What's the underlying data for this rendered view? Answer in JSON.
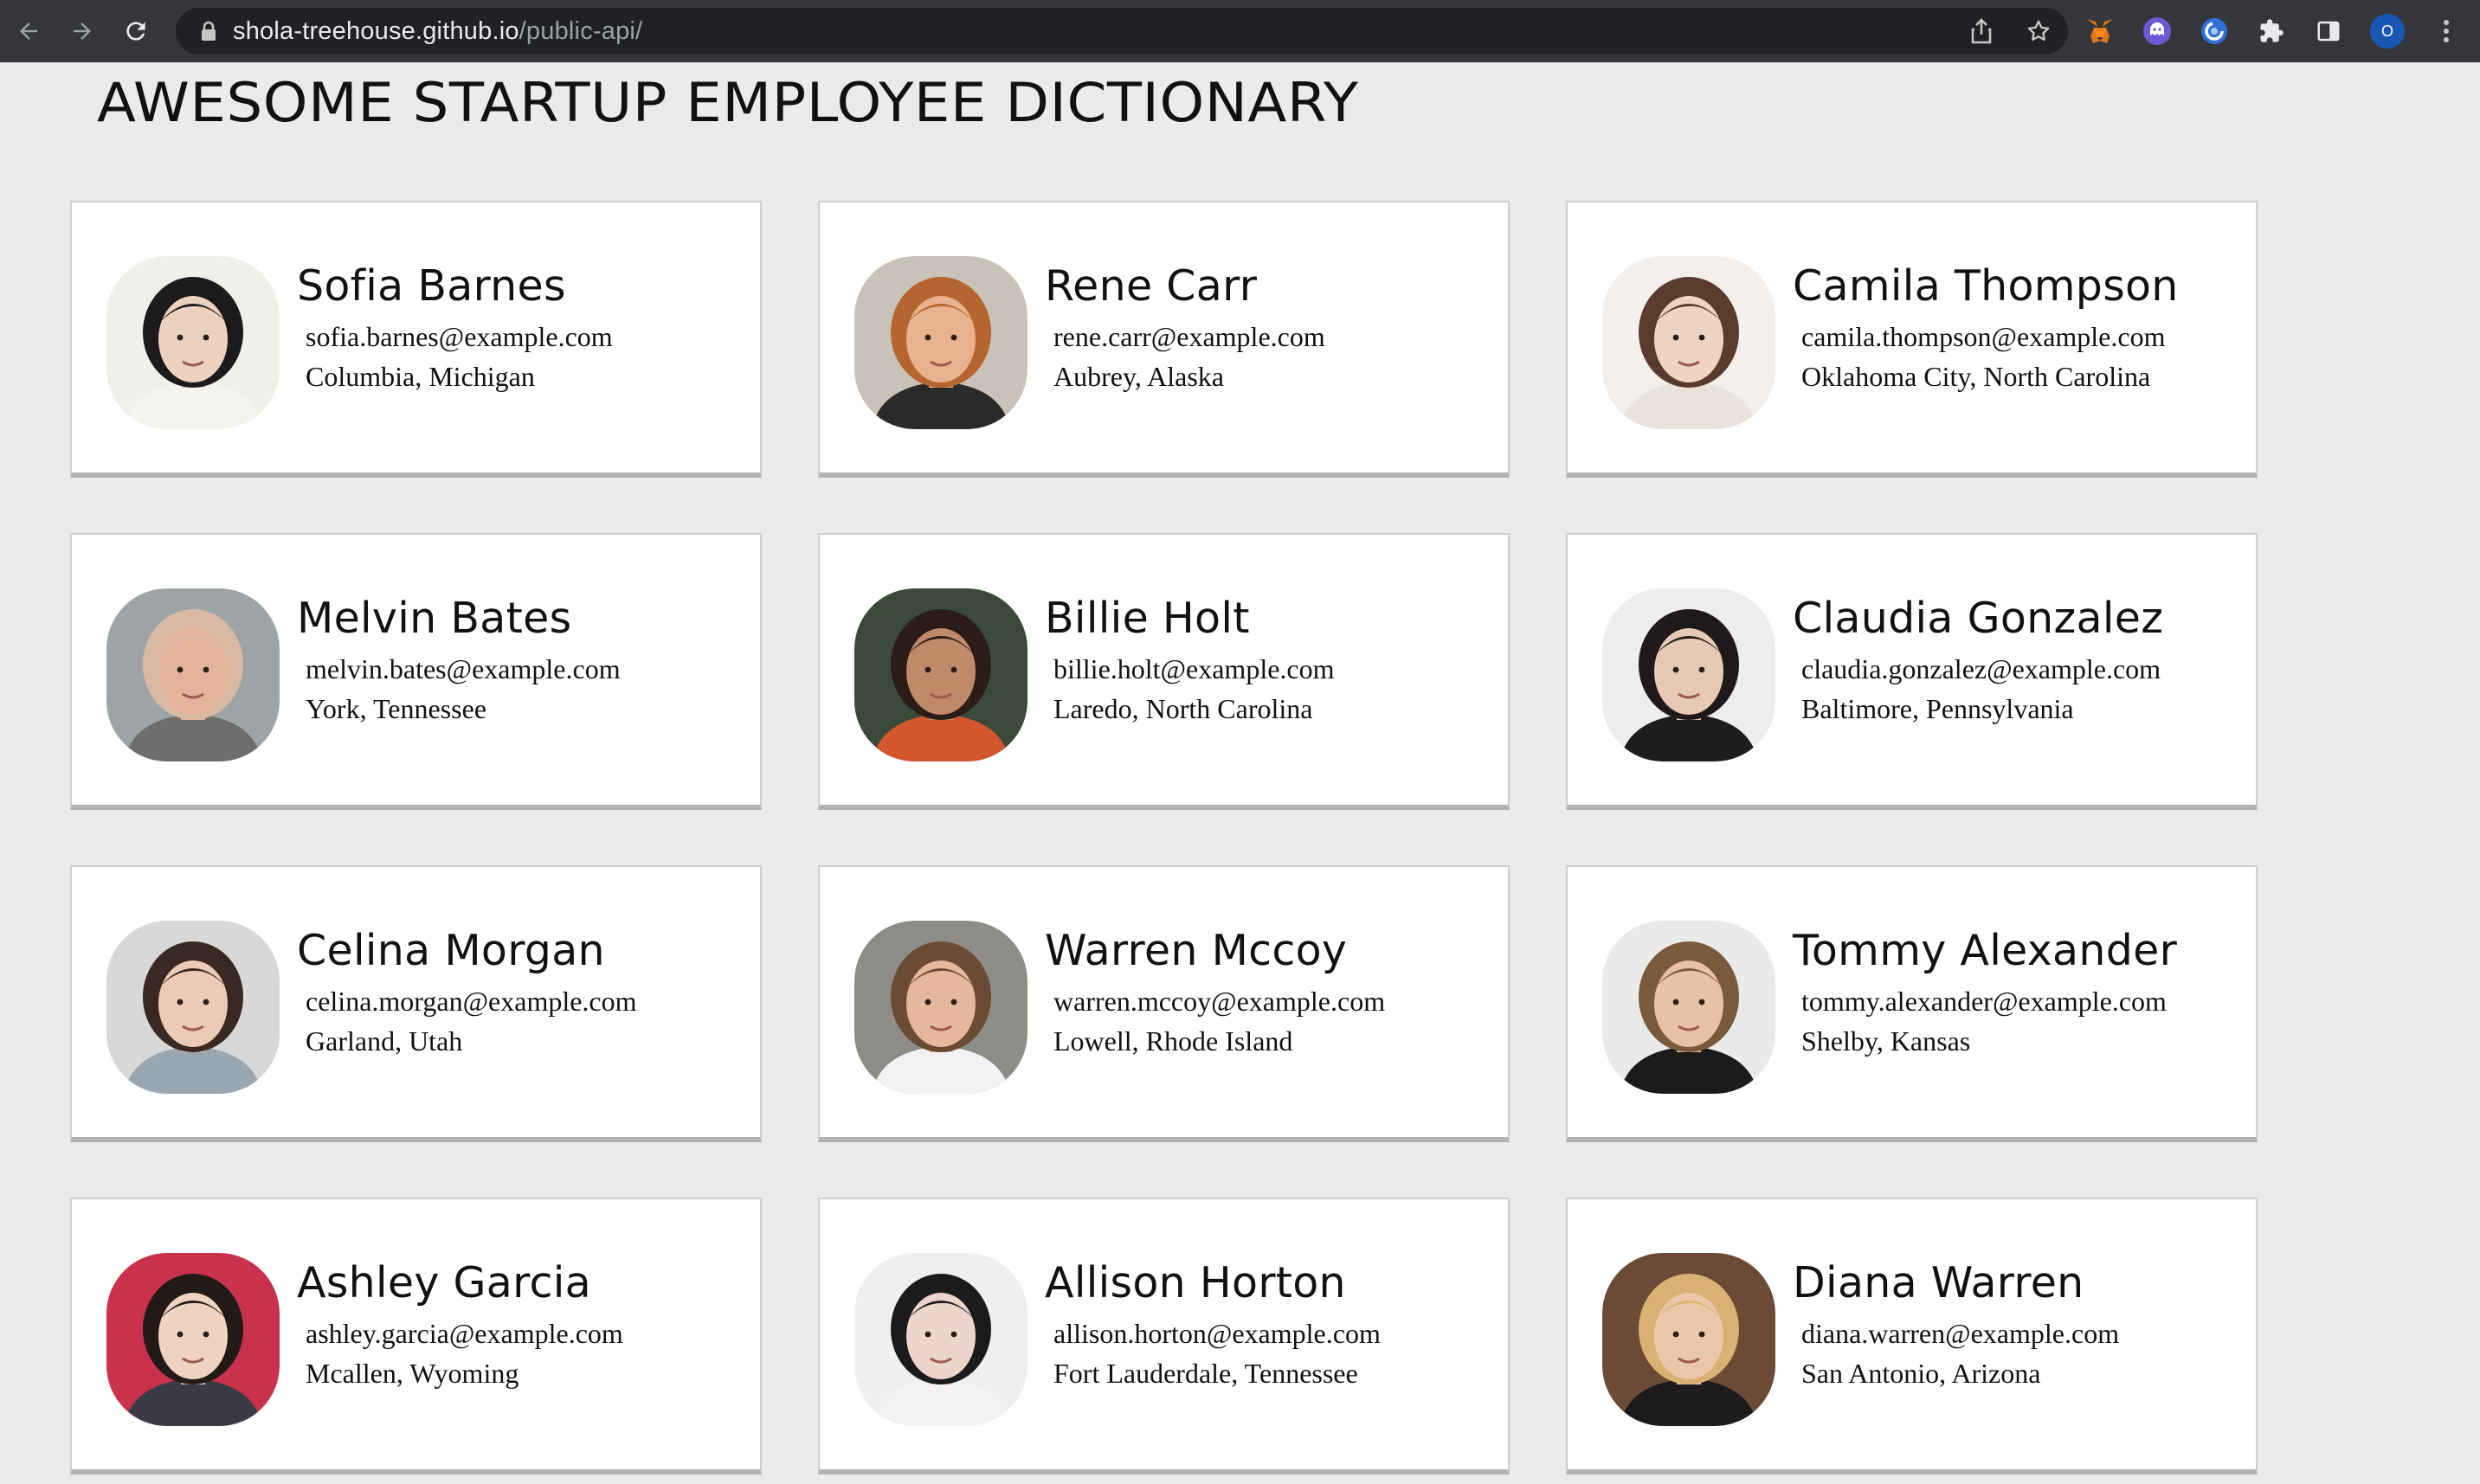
{
  "browser": {
    "url_host": "shola-treehouse.github.io",
    "url_path": "/public-api/",
    "profile_initial": "O",
    "icons": [
      "back-arrow-icon",
      "forward-arrow-icon",
      "reload-icon",
      "lock-icon",
      "share-icon",
      "star-icon",
      "metamask-fox-icon",
      "ghost-extension-icon",
      "sync-extension-icon",
      "puzzle-extensions-icon",
      "side-panel-icon",
      "kebab-menu-icon"
    ]
  },
  "page": {
    "title": "AWESOME STARTUP EMPLOYEE DICTIONARY"
  },
  "employees": [
    {
      "name": "Sofia Barnes",
      "email": "sofia.barnes@example.com",
      "location": "Columbia, Michigan",
      "photo_bg": "#f1efe9",
      "photo_hair": "#1c1a1c",
      "photo_skin": "#ecd0c0",
      "photo_shirt": "#f5f3ee"
    },
    {
      "name": "Rene Carr",
      "email": "rene.carr@example.com",
      "location": "Aubrey, Alaska",
      "photo_bg": "#c9c2b8",
      "photo_hair": "#b5652f",
      "photo_skin": "#e8b28f",
      "photo_shirt": "#2a2a2a"
    },
    {
      "name": "Camila Thompson",
      "email": "camila.thompson@example.com",
      "location": "Oklahoma City, North Carolina",
      "photo_bg": "#f3efec",
      "photo_hair": "#5a3b2e",
      "photo_skin": "#efd4c6",
      "photo_shirt": "#e9e2dd"
    },
    {
      "name": "Melvin Bates",
      "email": "melvin.bates@example.com",
      "location": "York, Tennessee",
      "photo_bg": "#9ea4a6",
      "photo_hair": "#d9b9a3",
      "photo_skin": "#e3b49b",
      "photo_shirt": "#6d6e6b"
    },
    {
      "name": "Billie Holt",
      "email": "billie.holt@example.com",
      "location": "Laredo, North Carolina",
      "photo_bg": "#3b4a38",
      "photo_hair": "#2b1c18",
      "photo_skin": "#c08a6a",
      "photo_shirt": "#d2562e"
    },
    {
      "name": "Claudia Gonzalez",
      "email": "claudia.gonzalez@example.com",
      "location": "Baltimore, Pennsylvania",
      "photo_bg": "#ededeb",
      "photo_hair": "#1f1a19",
      "photo_skin": "#e7c9b6",
      "photo_shirt": "#1d1d1d"
    },
    {
      "name": "Celina Morgan",
      "email": "celina.morgan@example.com",
      "location": "Garland, Utah",
      "photo_bg": "#d8d8d8",
      "photo_hair": "#3a2822",
      "photo_skin": "#edcab5",
      "photo_shirt": "#9aa6b0"
    },
    {
      "name": "Warren Mccoy",
      "email": "warren.mccoy@example.com",
      "location": "Lowell, Rhode Island",
      "photo_bg": "#8e8c86",
      "photo_hair": "#6b4b33",
      "photo_skin": "#e5b79b",
      "photo_shirt": "#f2f2f4"
    },
    {
      "name": "Tommy Alexander",
      "email": "tommy.alexander@example.com",
      "location": "Shelby, Kansas",
      "photo_bg": "#e9ebe9",
      "photo_hair": "#7a5a3c",
      "photo_skin": "#e9c2a6",
      "photo_shirt": "#1b1b1b"
    },
    {
      "name": "Ashley Garcia",
      "email": "ashley.garcia@example.com",
      "location": "Mcallen, Wyoming",
      "photo_bg": "#c8324d",
      "photo_hair": "#231a17",
      "photo_skin": "#efd2c0",
      "photo_shirt": "#3a3a44"
    },
    {
      "name": "Allison Horton",
      "email": "allison.horton@example.com",
      "location": "Fort Lauderdale, Tennessee",
      "photo_bg": "#f1eef0",
      "photo_hair": "#1b1b1e",
      "photo_skin": "#ecd6cc",
      "photo_shirt": "#f4f1f3"
    },
    {
      "name": "Diana Warren",
      "email": "diana.warren@example.com",
      "location": "San Antonio, Arizona",
      "photo_bg": "#6b4b36",
      "photo_hair": "#d9b172",
      "photo_skin": "#ecc6a8",
      "photo_shirt": "#1d1b1d"
    }
  ]
}
